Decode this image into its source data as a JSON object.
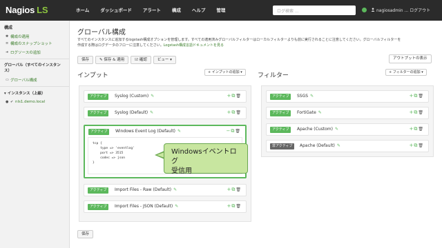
{
  "topbar": {
    "logo_main": "Nagios",
    "logo_suffix": "LS",
    "nav": [
      "ホーム",
      "ダッシュボード",
      "アラート",
      "構成",
      "ヘルプ",
      "管理"
    ],
    "search_placeholder": "ログ検索 ...",
    "user_label": "nagiosadmin ... ログアウト"
  },
  "sidebar": {
    "section1": "構成",
    "items1": [
      "構成の適用",
      "構成のスナップショット",
      "ログソースの追加"
    ],
    "section2": "グローバル（すべてのインスタンス）",
    "items2": [
      "グローバル構成"
    ],
    "section3": "インスタンス（上級）",
    "instances": [
      "nls1.demo.local"
    ]
  },
  "main": {
    "title": "グローバル構成",
    "desc1": "すべてのインスタンスに追加するlogstash構成オプションを管理します。すべての適用済みグローバルフィルターはローカルフィルターよりも前に実行されることに注意してください。グローバルフィルターを",
    "desc2": "作成する際はログデータのフローに注意してください。",
    "desc_link": "Logstash構成言語ドキュメントを見る",
    "toolbar": {
      "save": "保存",
      "save_apply": "保存 & 適用",
      "verify": "確認",
      "view": "ビュー"
    },
    "output_button": "アウトプットの表示",
    "bottom_save": "保存"
  },
  "inputs": {
    "title": "インプット",
    "add_label": "インプットの追加",
    "rows": [
      {
        "badge": "アクティブ",
        "name": "Syslog (Custom)"
      },
      {
        "badge": "アクティブ",
        "name": "Syslog (Default)"
      },
      {
        "badge": "アクティブ",
        "name": "Windows Event Log (Default)"
      },
      {
        "badge": "アクティブ",
        "name": "Import Files - Raw (Default)"
      },
      {
        "badge": "アクティブ",
        "name": "Import Files - JSON (Default)"
      }
    ],
    "code": "tcp {\n    type => 'eventlog'\n    port => 3515\n    codec => json\n}"
  },
  "filters": {
    "title": "フィルター",
    "add_label": "フィルターの追加",
    "rows": [
      {
        "badge": "アクティブ",
        "name": "SSGS"
      },
      {
        "badge": "アクティブ",
        "name": "FortiGate"
      },
      {
        "badge": "アクティブ",
        "name": "Apache (Custom)"
      },
      {
        "badge": "非アクティブ",
        "name": "Apache (Default)"
      }
    ]
  },
  "callout": {
    "line1": "Windowsイベントログ",
    "line2": "受信用"
  },
  "colors": {
    "accent": "#5cb85c",
    "topbar": "#2b2b2b",
    "callout_bg": "#c8e6a0",
    "inactive": "#666666"
  }
}
